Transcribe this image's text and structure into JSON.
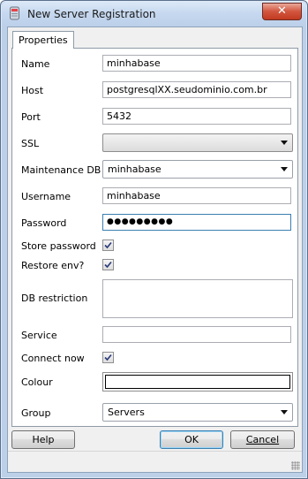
{
  "window": {
    "title": "New Server Registration",
    "close_glyph": "✕"
  },
  "tabs": [
    {
      "label": "Properties"
    }
  ],
  "fields": {
    "name": {
      "label": "Name",
      "value": "minhabase"
    },
    "host": {
      "label": "Host",
      "value": "postgresqlXX.seudominio.com.br"
    },
    "port": {
      "label": "Port",
      "value": "5432"
    },
    "ssl": {
      "label": "SSL",
      "value": ""
    },
    "maintenance_db": {
      "label": "Maintenance DB",
      "value": "minhabase"
    },
    "username": {
      "label": "Username",
      "value": "minhabase"
    },
    "password": {
      "label": "Password",
      "value": "●●●●●●●●●"
    },
    "store_password": {
      "label": "Store password",
      "checked": true
    },
    "restore_env": {
      "label": "Restore env?",
      "checked": true
    },
    "db_restriction": {
      "label": "DB restriction",
      "value": ""
    },
    "service": {
      "label": "Service",
      "value": ""
    },
    "connect_now": {
      "label": "Connect now",
      "checked": true
    },
    "colour": {
      "label": "Colour",
      "value": "#ffffff"
    },
    "group": {
      "label": "Group",
      "value": "Servers"
    }
  },
  "buttons": {
    "help": "Help",
    "ok": "OK",
    "cancel": "Cancel"
  }
}
